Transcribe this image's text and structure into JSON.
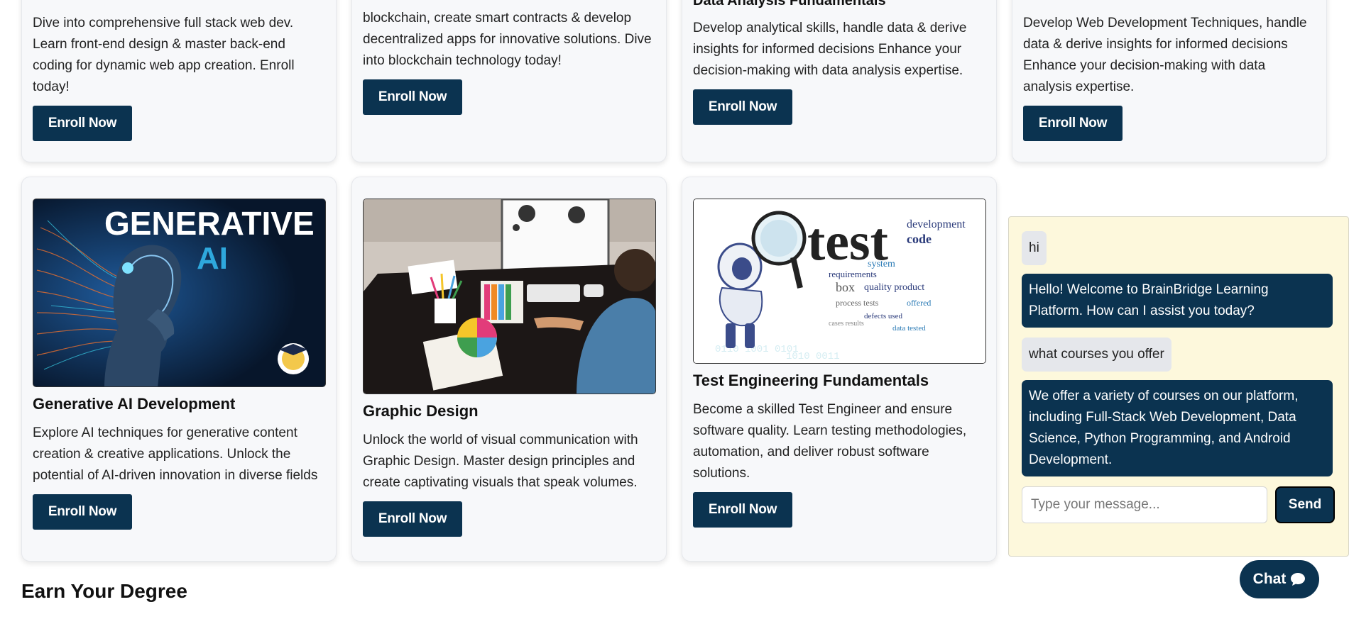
{
  "top_row": [
    {
      "title_partial": "",
      "description": "Dive into comprehensive full stack web dev. Learn front-end design & master back-end coding for dynamic web app creation. Enroll today!",
      "button": "Enroll Now"
    },
    {
      "title_partial": "",
      "description": "blockchain, create smart contracts & develop decentralized apps for innovative solutions. Dive into blockchain technology today!",
      "button": "Enroll Now"
    },
    {
      "title_partial": "Data Analysis Fundamentals",
      "description": "Develop analytical skills, handle data & derive insights for informed decisions Enhance your decision-making with data analysis expertise.",
      "button": "Enroll Now"
    },
    {
      "title_partial": "",
      "description": "Develop Web Development Techniques, handle data & derive insights for informed decisions Enhance your decision-making with data analysis expertise.",
      "button": "Enroll Now"
    }
  ],
  "courses": [
    {
      "title": "Generative AI Development",
      "description": "Explore AI techniques for generative content creation & creative applications. Unlock the potential of AI-driven innovation in diverse fields",
      "button": "Enroll Now",
      "image_text_1": "GENERATIVE",
      "image_text_2": "AI"
    },
    {
      "title": "Graphic Design",
      "description": "Unlock the world of visual communication with Graphic Design. Master design principles and create captivating visuals that speak volumes.",
      "button": "Enroll Now"
    },
    {
      "title": "Test Engineering Fundamentals",
      "description": "Become a skilled Test Engineer and ensure software quality. Learn testing methodologies, automation, and deliver robust software solutions.",
      "button": "Enroll Now",
      "image_text": "test"
    }
  ],
  "chat": {
    "messages": [
      {
        "role": "user",
        "text": "hi"
      },
      {
        "role": "bot",
        "text": "Hello! Welcome to BrainBridge Learning Platform. How can I assist you today?"
      },
      {
        "role": "user",
        "text": "what courses you offer"
      },
      {
        "role": "bot",
        "text": "We offer a variety of courses on our platform, including Full-Stack Web Development, Data Science, Python Programming, and Android Development."
      }
    ],
    "input_placeholder": "Type your message...",
    "send_label": "Send",
    "toggle_label": "Chat"
  },
  "section_heading": "Earn Your Degree",
  "colors": {
    "primary": "#0b3350",
    "card_bg": "#f7f8fa",
    "chat_bg": "#fdf8dc"
  }
}
